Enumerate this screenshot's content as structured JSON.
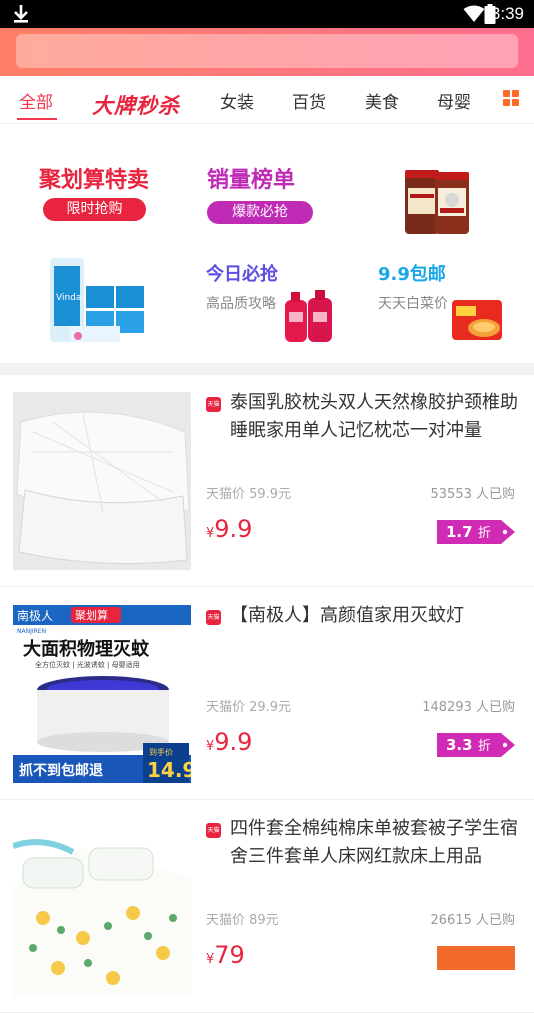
{
  "status": {
    "time": "3:39"
  },
  "search": {
    "placeholder": ""
  },
  "tabs": [
    {
      "label": "全部"
    },
    {
      "label": "大牌秒杀"
    },
    {
      "label": "女装"
    },
    {
      "label": "百货"
    },
    {
      "label": "美食"
    },
    {
      "label": "母婴"
    }
  ],
  "promo": {
    "ju": {
      "title": "聚划算特卖",
      "pill": "限时抢购"
    },
    "rank": {
      "title": "销量榜单",
      "pill": "爆款必抢"
    },
    "today": {
      "title": "今日必抢",
      "sub": "高品质攻略"
    },
    "nine": {
      "title": "9.9包邮",
      "sub": "天天白菜价"
    }
  },
  "products": [
    {
      "badge": "天猫",
      "title": "泰国乳胶枕头双人天然橡胶护颈椎助睡眠家用单人记忆枕芯一对冲量",
      "orig_price": "天猫价 59.9元",
      "sold": "53553 人已购",
      "currency": "¥",
      "price": "9.9",
      "discount": "1.7",
      "discount_unit": "折"
    },
    {
      "badge": "天猫",
      "title": "【南极人】高颜值家用灭蚊灯",
      "orig_price": "天猫价 29.9元",
      "sold": "148293 人已购",
      "currency": "¥",
      "price": "9.9",
      "discount": "3.3",
      "discount_unit": "折",
      "image_text": {
        "brand": "南极人",
        "brand_en": "NANJIREN",
        "ju": "聚划算",
        "headline": "大面积物理灭蚊",
        "features": "全方位灭蚊 | 光波诱蚊 | 母婴适用",
        "footer": "抓不到包邮退",
        "hand_price_label": "到手价",
        "hand_price": "14.9"
      }
    },
    {
      "badge": "天猫",
      "title": "四件套全棉纯棉床单被套被子学生宿舍三件套单人床网红款床上用品",
      "orig_price": "天猫价 89元",
      "sold": "26615 人已购",
      "currency": "¥",
      "price": "79",
      "discount": "",
      "discount_unit": ""
    }
  ],
  "colors": {
    "accent": "#e8243f",
    "purple": "#c02bb6",
    "header_from": "#ff7f66",
    "header_to": "#ff6f8f"
  }
}
